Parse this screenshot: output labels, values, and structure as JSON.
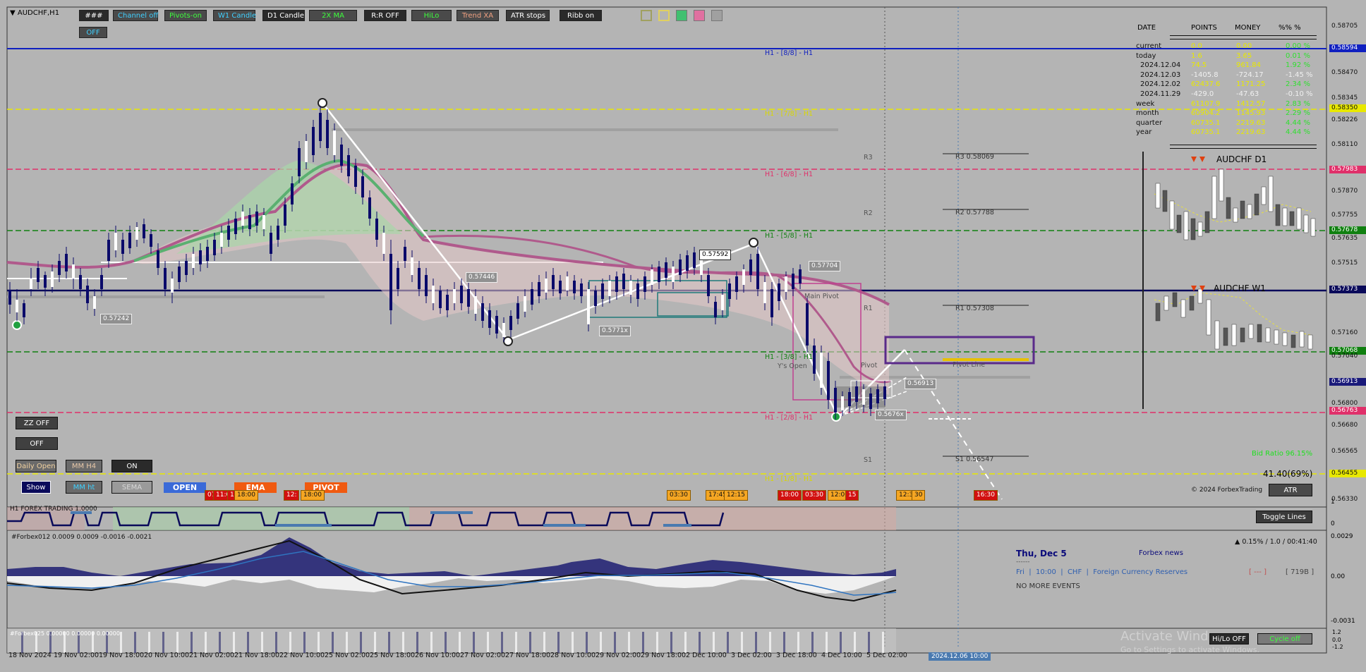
{
  "window": {
    "symbol": "AUDCHF,H1"
  },
  "toolbar": [
    {
      "label": "###",
      "bg": "#2a2a2a",
      "fg": "#ffffff"
    },
    {
      "label": "Channel off",
      "bg": "#4a4a4a",
      "fg": "#3fd0ff"
    },
    {
      "label": "Pivots-on",
      "bg": "#4a4a4a",
      "fg": "#3cff3c"
    },
    {
      "label": "W1 Candle",
      "bg": "#4a4a4a",
      "fg": "#3fd0ff"
    },
    {
      "label": "D1 Candle",
      "bg": "#2a2a2a",
      "fg": "#ffffff"
    },
    {
      "label": "2X MA",
      "bg": "#4a4a4a",
      "fg": "#3cff3c"
    },
    {
      "label": "R:R OFF",
      "bg": "#2a2a2a",
      "fg": "#ffffff"
    },
    {
      "label": "HiLo",
      "bg": "#4a4a4a",
      "fg": "#3cff3c"
    },
    {
      "label": "Trend XA",
      "bg": "#4a4a4a",
      "fg": "#f0a080"
    },
    {
      "label": "ATR stops",
      "bg": "#3a3a3a",
      "fg": "#ffffff"
    },
    {
      "label": "Ribb on",
      "bg": "#2a2a2a",
      "fg": "#ffffff"
    }
  ],
  "toolbar2_label": "OFF",
  "swatches": [
    "#a0a060",
    "#e0d060",
    "#40c070",
    "#e070a0",
    "#a0a0a0"
  ],
  "side_buttons": {
    "zz": "ZZ OFF",
    "off": "OFF",
    "daily_open": "Daily Open",
    "mm_h4": "MM H4",
    "on": "ON",
    "show": "Show",
    "mm_ht": "MM ht",
    "sema": "SEMA"
  },
  "session_tags": {
    "open": "OPEN",
    "ema": "EMA",
    "pivot": "PIVOT"
  },
  "murrey_levels": [
    {
      "label": "H1 - [8/8] - H1",
      "color": "#1020c0"
    },
    {
      "label": "H1 - [7/8] - H1",
      "color": "#d8d800"
    },
    {
      "label": "H1 - [6/8] - H1",
      "color": "#e0306a"
    },
    {
      "label": "H1 - [5/8] - H1",
      "color": "#108010"
    },
    {
      "label": "H1 - [3/8] - H1",
      "color": "#108010"
    },
    {
      "label": "H1 - [2/8] - H1",
      "color": "#e0306a"
    },
    {
      "label": "H1 - [1/8] - H1",
      "color": "#d8d800"
    }
  ],
  "pivots": {
    "r3_tag": "R3",
    "r2_tag": "R2",
    "r1_tag": "R1",
    "s1_tag": "S1",
    "r3": "R3 0.58069",
    "r2": "R2 0.57788",
    "r1": "R1 0.57308",
    "s1": "S1 0.56547",
    "pivot_line": "Pivot Line",
    "pivot": "Pivot",
    "main_pivot": "Main Pivot",
    "ys_open": "Y's Open"
  },
  "price_labels": {
    "p57242": "0.57242",
    "p57446": "0.57446",
    "p57592": "0.57592",
    "p57714": "0.5771x",
    "p57704": "0.57704",
    "p56913": "0.56913",
    "p56763": "0.5676x"
  },
  "y_axis": [
    {
      "v": "0.58705",
      "c": "#111",
      "b": ""
    },
    {
      "v": "0.58594",
      "c": "#fff",
      "b": "#1020c0"
    },
    {
      "v": "0.58470",
      "c": "#111",
      "b": ""
    },
    {
      "v": "0.58345",
      "c": "#111",
      "b": ""
    },
    {
      "v": "0.58226",
      "c": "#111",
      "b": ""
    },
    {
      "v": "0.58110",
      "c": "#111",
      "b": ""
    },
    {
      "v": "0.57983",
      "c": "#fff",
      "b": "#e0306a"
    },
    {
      "v": "0.57870",
      "c": "#111",
      "b": ""
    },
    {
      "v": "0.57755",
      "c": "#111",
      "b": ""
    },
    {
      "v": "0.57678",
      "c": "#fff",
      "b": "#108010"
    },
    {
      "v": "0.57635",
      "c": "#111",
      "b": ""
    },
    {
      "v": "0.57515",
      "c": "#111",
      "b": ""
    },
    {
      "v": "0.57373",
      "c": "#fff",
      "b": "#0a0a5a"
    },
    {
      "v": "0.57160",
      "c": "#111",
      "b": ""
    },
    {
      "v": "0.57068",
      "c": "#fff",
      "b": "#108010"
    },
    {
      "v": "0.57040",
      "c": "#111",
      "b": ""
    },
    {
      "v": "0.56913",
      "c": "#fff",
      "b": "#1a1a7a"
    },
    {
      "v": "0.56800",
      "c": "#111",
      "b": ""
    },
    {
      "v": "0.56763",
      "c": "#fff",
      "b": "#e0306a"
    },
    {
      "v": "0.56680",
      "c": "#111",
      "b": ""
    },
    {
      "v": "0.56565",
      "c": "#111",
      "b": ""
    },
    {
      "v": "0.56450",
      "c": "#111",
      "b": ""
    },
    {
      "v": "0.56330",
      "c": "#111",
      "b": ""
    },
    {
      "v": "0.58350",
      "c": "#111",
      "b": "#e8e800"
    },
    {
      "v": "0.56455",
      "c": "#111",
      "b": "#e8e800"
    }
  ],
  "stats": {
    "headers": [
      "DATE",
      "POINTS",
      "MONEY",
      "%% %"
    ],
    "rows": [
      {
        "d": "current",
        "p": "0.0",
        "m": "0.00",
        "pc": "0.00 %"
      },
      {
        "d": "today",
        "p": "1.6",
        "m": "3.65",
        "pc": "0.01 %"
      },
      {
        "d": "2024.12.04",
        "p": "74.5",
        "m": "961.84",
        "pc": "1.92 %"
      },
      {
        "d": "2024.12.03",
        "p": "-1405.8",
        "m": "-724.17",
        "pc": "-1.45 %"
      },
      {
        "d": "2024.12.02",
        "p": "62437.6",
        "m": "1171.25",
        "pc": "2.34 %"
      },
      {
        "d": "2024.11.29",
        "p": "-429.0",
        "m": "-47.63",
        "pc": "-0.10 %"
      },
      {
        "d": "week",
        "p": "61107.9",
        "m": "1412.57",
        "pc": "2.83 %"
      },
      {
        "d": "month",
        "p": "60904.2",
        "m": "1145.93",
        "pc": "2.29 %"
      },
      {
        "d": "quarter",
        "p": "60735.1",
        "m": "2219.63",
        "pc": "4.44 %"
      },
      {
        "d": "year",
        "p": "60735.1",
        "m": "2219.63",
        "pc": "4.44 %"
      }
    ]
  },
  "mini_charts": {
    "d1": "AUDCHF D1",
    "w1": "AUDCHF W1"
  },
  "bid_ratio": "Bid Ratio 96.15%",
  "atr_value": "41.40(69%)",
  "atr_button": "ATR",
  "copyright": "© 2024 ForbexTrading",
  "toggle_lines": "Toggle Lines",
  "session_times": [
    {
      "t": "07:1",
      "red": true
    },
    {
      "t": "11:0",
      "red": true
    },
    {
      "t": "1",
      "red": true
    },
    {
      "t": "18:00",
      "red": false
    },
    {
      "t": "12:",
      "red": true
    },
    {
      "t": "18:00",
      "red": false
    },
    {
      "t": "03:30",
      "red": false
    },
    {
      "t": "17:45",
      "red": false
    },
    {
      "t": "12:15",
      "red": false
    },
    {
      "t": "18:00",
      "red": true
    },
    {
      "t": "03:30",
      "red": true
    },
    {
      "t": "12:00",
      "red": false
    },
    {
      "t": "15",
      "red": true
    },
    {
      "t": "12:30",
      "red": false
    },
    {
      "t": "30",
      "red": false
    },
    {
      "t": "16:30",
      "red": true
    }
  ],
  "sub1_label": "H1 FOREX TRADING 1.0000",
  "sub1_axis": [
    "1",
    "0"
  ],
  "sub2_label": "#Forbex012 0.0009 0.0009 -0.0016 -0.0021",
  "sub2_axis": [
    "0.0029",
    "0.00",
    "-0.0031"
  ],
  "sub3_label": "#Forbex025 0.00000 0.00000 0.00000",
  "sub3_axis": [
    "1.2",
    "0.0",
    "-1.2"
  ],
  "news": {
    "date": "Thu, Dec 5",
    "title": "Forbex news",
    "stats": "▲ 0.15% / 1.0 / 00:41:40",
    "sep": "------",
    "day": "Fri",
    "time": "10:00",
    "currency": "CHF",
    "event": "Foreign Currency Reserves",
    "actual": "[ --- ]",
    "prev": "[ 719B ]",
    "no_more": "NO MORE EVENTS"
  },
  "bottom_buttons": {
    "hilo": "Hi/Lo OFF",
    "cycle": "Cycle off"
  },
  "watermark": {
    "line1": "Activate Windows",
    "line2": "Go to Settings to activate Windows."
  },
  "x_axis": [
    "18 Nov 2024",
    "19 Nov 02:00",
    "19 Nov 18:00",
    "20 Nov 10:00",
    "21 Nov 02:00",
    "21 Nov 18:00",
    "22 Nov 10:00",
    "25 Nov 02:00",
    "25 Nov 18:00",
    "26 Nov 10:00",
    "27 Nov 02:00",
    "27 Nov 18:00",
    "28 Nov 10:00",
    "29 Nov 02:00",
    "29 Nov 18:00",
    "2 Dec 10:00",
    "3 Dec 02:00",
    "3 Dec 18:00",
    "4 Dec 10:00",
    "5 Dec 02:00"
  ],
  "x_axis_highlight": "2024.12.06 10:00"
}
